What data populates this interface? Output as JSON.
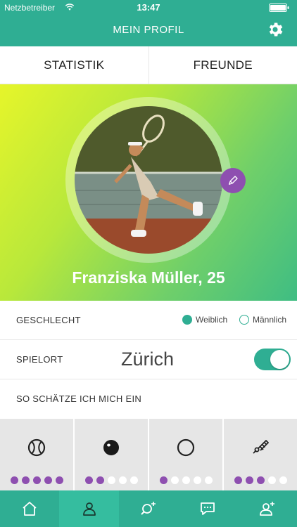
{
  "status": {
    "carrier": "Netzbetreiber",
    "time": "13:47"
  },
  "nav": {
    "title": "MEIN PROFIL"
  },
  "tabs": [
    {
      "label": "STATISTIK"
    },
    {
      "label": "FREUNDE"
    }
  ],
  "profile": {
    "name": "Franziska Müller, 25"
  },
  "gender": {
    "label": "GESCHLECHT",
    "options": [
      {
        "label": "Weiblich",
        "selected": true
      },
      {
        "label": "Männlich",
        "selected": false
      }
    ]
  },
  "place": {
    "label": "SPIELORT",
    "value": "Zürich",
    "toggle_on": true
  },
  "self_assessment": {
    "label": "SO SCHÄTZE ICH MICH EIN",
    "skills": [
      {
        "icon": "tennis-ball-icon",
        "rating": 5,
        "max": 5
      },
      {
        "icon": "squash-ball-icon",
        "rating": 2,
        "max": 5
      },
      {
        "icon": "ring-icon",
        "rating": 1,
        "max": 5
      },
      {
        "icon": "badminton-shuttlecock-icon",
        "rating": 3,
        "max": 5
      }
    ]
  },
  "tabbar": [
    {
      "icon": "home-icon",
      "active": false
    },
    {
      "icon": "profile-icon",
      "active": true
    },
    {
      "icon": "search-add-icon",
      "active": false
    },
    {
      "icon": "chat-icon",
      "active": false
    },
    {
      "icon": "add-user-icon",
      "active": false
    }
  ],
  "colors": {
    "primary": "#2fae93",
    "accent": "#8e4fb0",
    "gradient_start": "#e6f52a",
    "gradient_end": "#3fbd83"
  }
}
